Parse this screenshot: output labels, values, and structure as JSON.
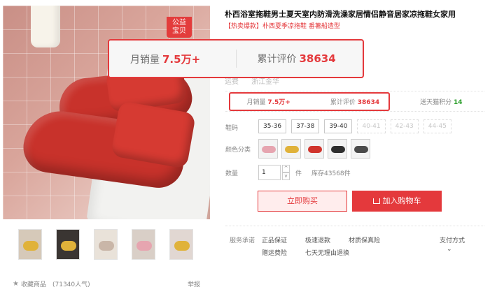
{
  "product": {
    "title": "朴西浴室拖鞋男士夏天室内防滑洗澡家居情侣静音居家凉拖鞋女家用",
    "subtitle": "【热卖爆款】朴西夏季凉拖鞋 番薯船造型",
    "badge": "公益\n宝贝"
  },
  "zoom": {
    "sales_label": "月销量",
    "sales_value": "7.5万+",
    "reviews_label": "累计评价",
    "reviews_value": "38634"
  },
  "faded_row": {
    "label": "运费",
    "value": "浙江金华"
  },
  "stats": {
    "sales_label": "月销量",
    "sales_value": "7.5万+",
    "reviews_label": "累计评价",
    "reviews_value": "38634",
    "points_label": "送天猫积分",
    "points_value": "14"
  },
  "size": {
    "label": "鞋码",
    "options": [
      "35-36",
      "37-38",
      "39-40",
      "40-41",
      "42-43",
      "44-45"
    ]
  },
  "color": {
    "label": "颜色分类",
    "swatch_colors": [
      "#e6a5b0",
      "#e0b23a",
      "#d0342c",
      "#2f2f2f",
      "#4a4a4a"
    ]
  },
  "quantity": {
    "label": "数量",
    "value": "1",
    "unit": "件",
    "stock": "库存43568件"
  },
  "buttons": {
    "buy": "立即购买",
    "cart": "加入购物车"
  },
  "service": {
    "label": "服务承诺",
    "items": [
      "正品保证",
      "极速退款",
      "材质保真险",
      "赠运费险",
      "七天无理由退换"
    ],
    "pay_label": "支付方式"
  },
  "footer": {
    "fav_label": "收藏商品",
    "fav_count": "(71340人气)",
    "report": "举报"
  },
  "colors": {
    "accent": "#e4393c",
    "green": "#2a9d2a"
  }
}
